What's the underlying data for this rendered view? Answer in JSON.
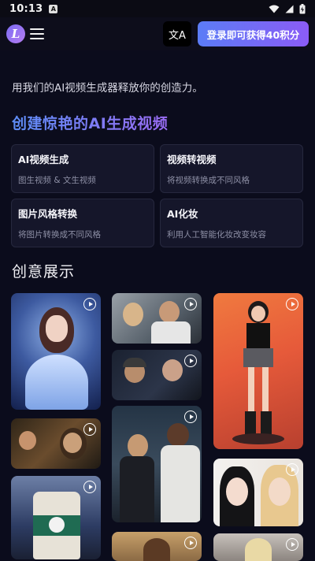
{
  "status_bar": {
    "time": "10:13",
    "notification_icon": "A"
  },
  "header": {
    "logo_letter": "L",
    "translate_icon": "文A",
    "login_button": "登录即可获得40积分"
  },
  "intro": {
    "subtitle": "用我们的AI视频生成器释放你的创造力。",
    "title": "创建惊艳的AI生成视频"
  },
  "features": [
    {
      "title": "AI视频生成",
      "desc": "图生视频 & 文生视频"
    },
    {
      "title": "视频转视频",
      "desc": "将视频转换成不同风格"
    },
    {
      "title": "图片风格转换",
      "desc": "将图片转换成不同风格"
    },
    {
      "title": "AI化妆",
      "desc": "利用人工智能化妆改变妆容"
    }
  ],
  "showcase": {
    "title": "创意展示"
  },
  "colors": {
    "accent_start": "#5b7cf6",
    "accent_end": "#8b5cf6",
    "background": "#0b0c1c"
  }
}
